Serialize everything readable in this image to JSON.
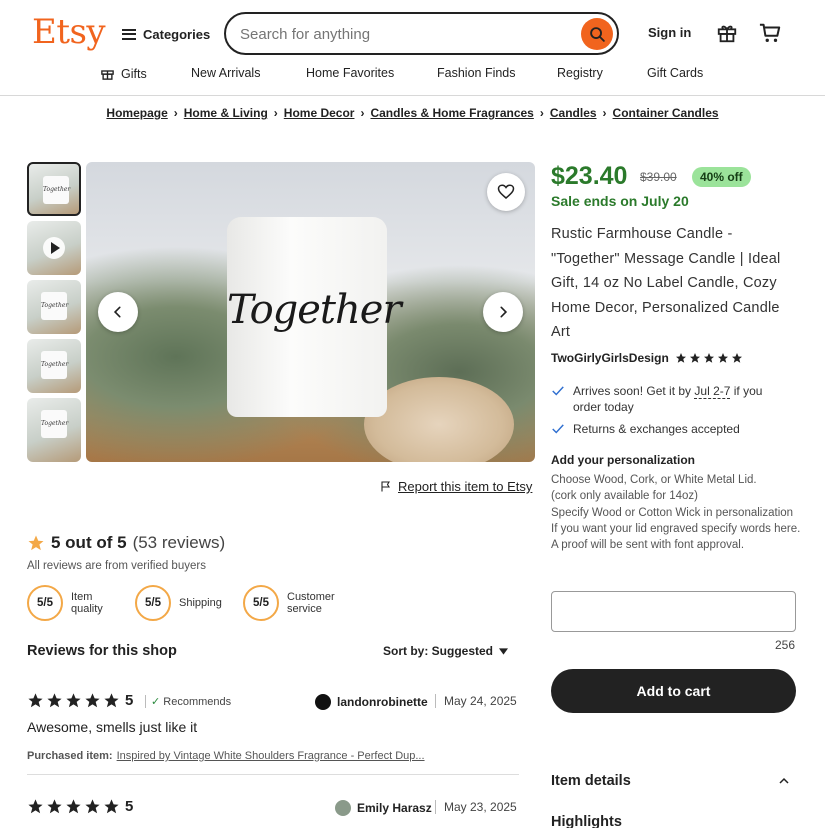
{
  "header": {
    "logo": "Etsy",
    "categories": "Categories",
    "search_placeholder": "Search for anything",
    "sign_in": "Sign in",
    "nav": [
      "Gifts",
      "New Arrivals",
      "Home Favorites",
      "Fashion Finds",
      "Registry",
      "Gift Cards"
    ]
  },
  "breadcrumb": [
    "Homepage",
    "Home & Living",
    "Home Decor",
    "Candles & Home Fragrances",
    "Candles",
    "Container Candles"
  ],
  "gallery": {
    "candle_text": "Together",
    "report": "Report this item to Etsy"
  },
  "reviews": {
    "rating_text": "5 out of 5",
    "count_text": "(53 reviews)",
    "verified": "All reviews are from verified buyers",
    "scores": [
      {
        "value": "5/5",
        "label": "Item quality"
      },
      {
        "value": "5/5",
        "label": "Shipping"
      },
      {
        "value": "5/5",
        "label": "Customer service"
      }
    ],
    "heading": "Reviews for this shop",
    "sort": "Sort by: Suggested",
    "items": [
      {
        "score": "5",
        "recommends": "Recommends",
        "user": "landonrobinette",
        "date": "May 24, 2025",
        "text": "Awesome, smells just like it",
        "purchased_label": "Purchased item:",
        "purchased_item": "Inspired by Vintage White Shoulders Fragrance - Perfect Dup..."
      },
      {
        "score": "5",
        "user": "Emily Harasz",
        "date": "May 23, 2025"
      }
    ]
  },
  "product": {
    "price": "$23.40",
    "original_price": "$39.00",
    "discount": "40% off",
    "sale_ends": "Sale ends on July 20",
    "title": "Rustic Farmhouse Candle - \"Together\" Message Candle | Ideal Gift, 14 oz No Label Candle, Cozy Home Decor, Personalized Candle Art",
    "shop": "TwoGirlyGirlsDesign",
    "arrives_pre": "Arrives soon! Get it by ",
    "arrives_date": "Jul 2-7",
    "arrives_post": " if you order today",
    "returns": "Returns & exchanges accepted",
    "personalization_title": "Add your personalization",
    "personalization_lines": [
      "Choose Wood, Cork, or White Metal Lid.",
      "(cork only available for 14oz)",
      "Specify Wood or Cotton Wick in personalization",
      "If you want your lid engraved specify words here. A proof will be sent with font approval."
    ],
    "char_count": "256",
    "add_to_cart": "Add to cart",
    "item_details": "Item details",
    "highlights": "Highlights"
  },
  "colors": {
    "brand": "#F1641E",
    "sale_green": "#2b7a2b",
    "discount_bg": "#9be39a"
  }
}
